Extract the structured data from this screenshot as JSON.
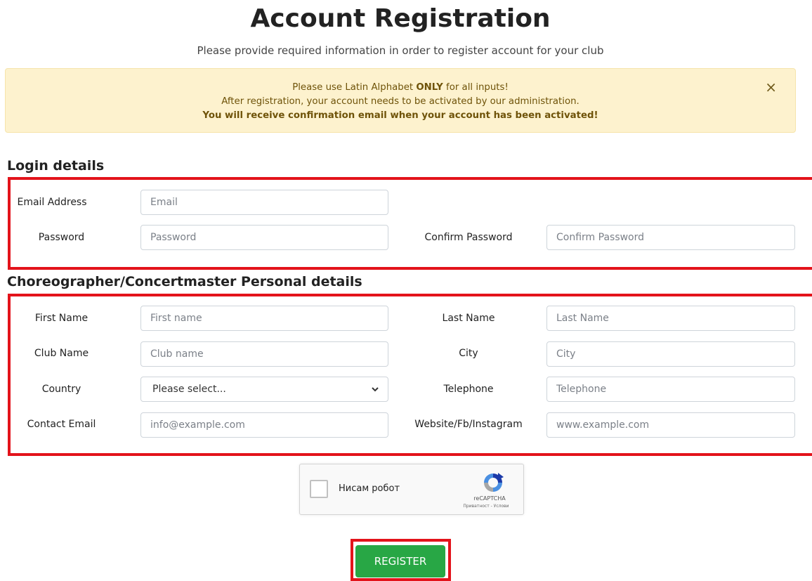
{
  "header": {
    "title": "Account Registration",
    "subtitle": "Please provide required information in order to register account for your club"
  },
  "alert": {
    "line1_prefix": "Please use Latin Alphabet ",
    "line1_bold": "ONLY",
    "line1_suffix": " for all inputs!",
    "line2": "After registration, your account needs to be activated by our administration.",
    "line3": "You will receive confirmation email when your account has been activated!",
    "close_label": "×"
  },
  "login": {
    "section_title": "Login details",
    "email_label": "Email Address",
    "email_placeholder": "Email",
    "password_label": "Password",
    "password_placeholder": "Password",
    "confirm_label": "Confirm Password",
    "confirm_placeholder": "Confirm Password"
  },
  "personal": {
    "section_title": "Choreographer/Concertmaster Personal details",
    "first_name_label": "First Name",
    "first_name_placeholder": "First name",
    "last_name_label": "Last Name",
    "last_name_placeholder": "Last Name",
    "club_label": "Club Name",
    "club_placeholder": "Club name",
    "city_label": "City",
    "city_placeholder": "City",
    "country_label": "Country",
    "country_value": "Please select...",
    "telephone_label": "Telephone",
    "telephone_placeholder": "Telephone",
    "contact_email_label": "Contact Email",
    "contact_email_placeholder": "info@example.com",
    "website_label": "Website/Fb/Instagram",
    "website_placeholder": "www.example.com"
  },
  "captcha": {
    "label": "Нисам робот",
    "brand": "reCAPTCHA",
    "terms": "Приватност - Услови"
  },
  "actions": {
    "register_label": "REGISTER"
  },
  "colors": {
    "highlight": "#e3131b",
    "alert_bg": "#fdf2ce",
    "register_bg": "#28a745"
  }
}
